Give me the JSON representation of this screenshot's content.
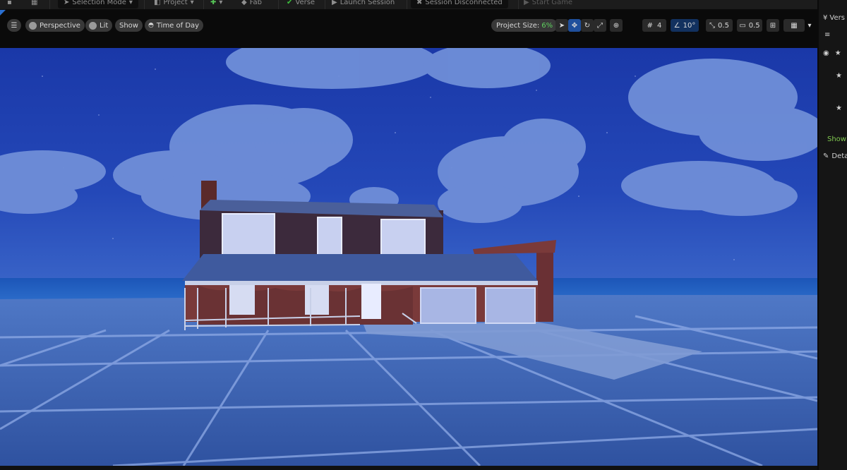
{
  "toolbar": {
    "selection_mode": "Selection Mode",
    "project": "Project",
    "fab": "Fab",
    "verse": "Verse",
    "launch_session": "Launch Session",
    "session_status": "Session Disconnected",
    "start_game": "Start Game"
  },
  "viewport_toolbar": {
    "perspective": "Perspective",
    "lit": "Lit",
    "show": "Show",
    "time_of_day": "Time of Day",
    "project_size_label": "Project Size:",
    "project_size_value": "6%",
    "grid_value": "4",
    "angle_value": "10°",
    "scale_value": "0.5",
    "camera_speed": "0.5"
  },
  "right_panel": {
    "title": "Vers",
    "showing": "Showi",
    "details": "Deta"
  },
  "colors": {
    "accent": "#1f4f9c",
    "sky": "#1f45b8",
    "ground": "#3a5ea8",
    "progress_green": "#5fd05f"
  }
}
